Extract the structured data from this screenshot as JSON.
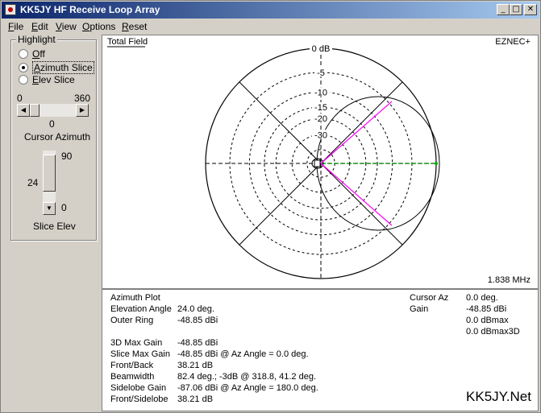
{
  "window": {
    "title": "KK5JY HF Receive Loop Array"
  },
  "title_buttons": [
    "_",
    "□",
    "✕"
  ],
  "menu": [
    {
      "pre": "",
      "ul": "F",
      "post": "ile"
    },
    {
      "pre": "",
      "ul": "E",
      "post": "dit"
    },
    {
      "pre": "",
      "ul": "V",
      "post": "iew"
    },
    {
      "pre": "",
      "ul": "O",
      "post": "ptions"
    },
    {
      "pre": "",
      "ul": "R",
      "post": "eset"
    }
  ],
  "highlight": {
    "title": "Highlight",
    "options": [
      {
        "pre": "",
        "ul": "O",
        "post": "ff",
        "checked": false
      },
      {
        "pre": "",
        "ul": "A",
        "post": "zimuth Slice",
        "checked": true
      },
      {
        "pre": "",
        "ul": "E",
        "post": "lev Slice",
        "checked": false
      }
    ]
  },
  "azimuth_scroll": {
    "min": "0",
    "max": "360",
    "value": "0",
    "label": "Cursor Azimuth",
    "fraction": 0.0
  },
  "elev_scroll": {
    "top": "90",
    "bottom": "0",
    "value": "24",
    "label": "Slice Elev",
    "fraction": 0.27
  },
  "plot": {
    "field_label": "Total Field",
    "program": "EZNEC+",
    "frequency": "1.838 MHz",
    "ring_labels": [
      "0 dB",
      "-5",
      "-10",
      "-15",
      "-20",
      "-30"
    ]
  },
  "colors": {
    "cursor": "#ff00ff",
    "azimuth_line": "#00b000",
    "titlebar": "#0a246a"
  },
  "info_left": [
    [
      "Azimuth Plot",
      ""
    ],
    [
      "Elevation Angle",
      "24.0 deg."
    ],
    [
      "Outer Ring",
      "-48.85 dBi"
    ],
    [
      "",
      ""
    ],
    [
      "3D Max Gain",
      "-48.85 dBi"
    ],
    [
      "Slice Max Gain",
      "-48.85 dBi @ Az Angle = 0.0 deg."
    ],
    [
      "Front/Back",
      "38.21 dB"
    ],
    [
      "Beamwidth",
      "82.4 deg.; -3dB @ 318.8, 41.2 deg."
    ],
    [
      "Sidelobe Gain",
      "-87.06 dBi @ Az Angle = 180.0 deg."
    ],
    [
      "Front/Sidelobe",
      "38.21 dB"
    ]
  ],
  "info_right": [
    [
      "Cursor Az",
      "0.0 deg."
    ],
    [
      "Gain",
      "-48.85 dBi"
    ],
    [
      "",
      "0.0 dBmax"
    ],
    [
      "",
      "0.0 dBmax3D"
    ]
  ],
  "brand": "KK5JY.Net"
}
